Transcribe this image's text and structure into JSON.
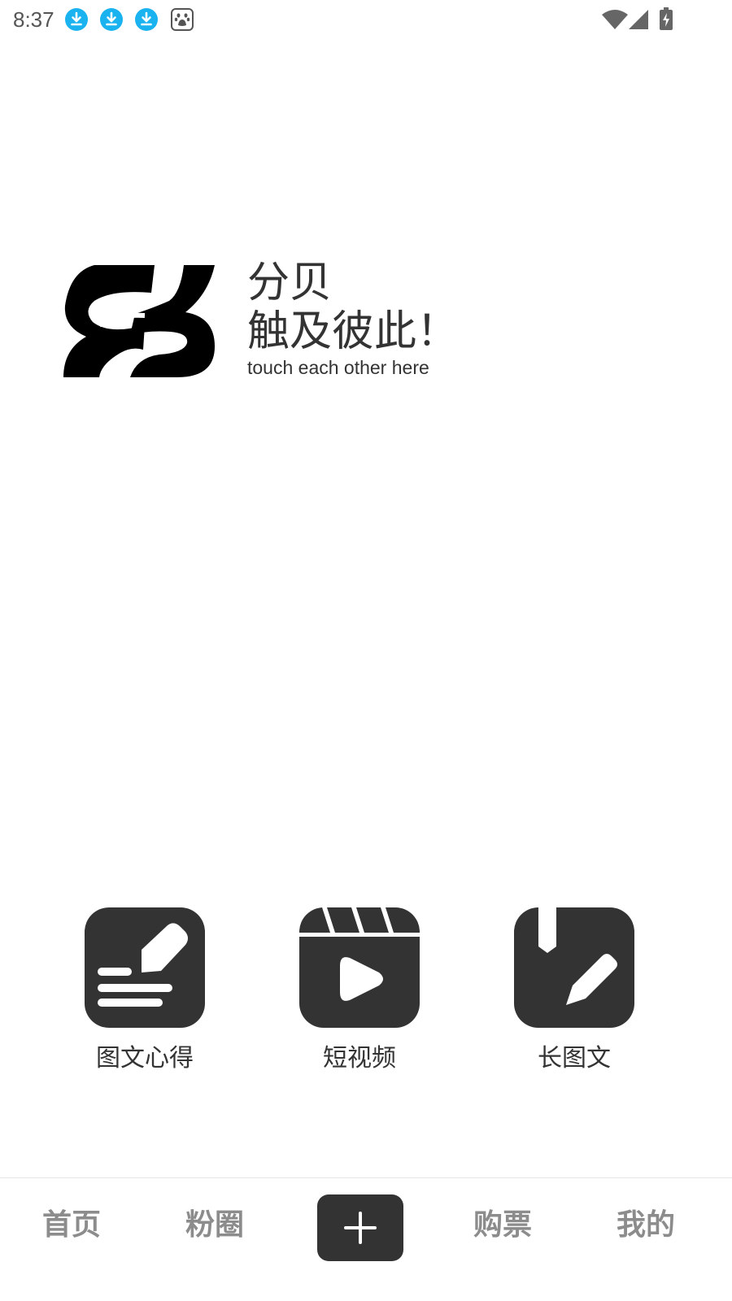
{
  "status_bar": {
    "time": "8:37",
    "notifications": [
      "download-icon",
      "download-icon",
      "download-icon",
      "baidu-paw-icon"
    ],
    "system_icons": [
      "wifi-icon",
      "cell-signal-icon",
      "battery-charging-icon"
    ]
  },
  "brand": {
    "name": "分贝",
    "slogan": "触及彼此！",
    "tagline": "touch each other here"
  },
  "publish_options": [
    {
      "label": "图文心得",
      "icon": "edit-note-icon"
    },
    {
      "label": "短视频",
      "icon": "video-clapper-icon"
    },
    {
      "label": "长图文",
      "icon": "bookmark-edit-icon"
    }
  ],
  "bottom_nav": {
    "items": [
      {
        "label": "首页"
      },
      {
        "label": "粉圈"
      },
      {
        "label": "购票"
      },
      {
        "label": "我的"
      }
    ],
    "add_icon": "plus-icon"
  },
  "colors": {
    "icon_dark": "#333333",
    "notif_blue": "#1ab3f0",
    "nav_inactive": "#8c8c8c"
  }
}
